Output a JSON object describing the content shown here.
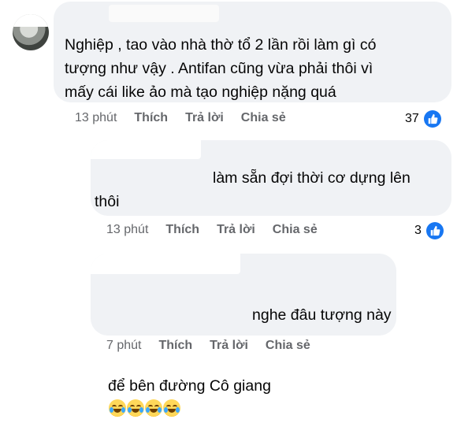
{
  "comments": [
    {
      "text": "Nghiệp , tao vào nhà thờ tổ 2 lần rồi làm gì có\ntượng như vậy . Antifan cũng vừa phải thôi vì\nmấy cái like ảo mà tạo nghiệp nặng quá",
      "time": "13 phút",
      "like_label": "Thích",
      "reply_label": "Trả lời",
      "share_label": "Chia sẻ",
      "reaction_count": "37"
    },
    {
      "text": "làm sẵn đợi thời cơ dựng lên\nthôi",
      "time": "13 phút",
      "like_label": "Thích",
      "reply_label": "Trả lời",
      "share_label": "Chia sẻ",
      "reaction_count": "3"
    },
    {
      "text_line1": "nghe đâu tượng này",
      "text_line2": "để bên đường Cô giang",
      "emoji_count": 4,
      "time": "7 phút",
      "like_label": "Thích",
      "reply_label": "Trả lời",
      "share_label": "Chia sẻ"
    }
  ],
  "colors": {
    "bubble": "#f0f2f5",
    "secondary_text": "#65676b",
    "like_blue": "#1877f2"
  },
  "icons": {
    "reaction": "thumbs-up-icon",
    "emoji": "face-with-tears-of-joy-icon"
  }
}
